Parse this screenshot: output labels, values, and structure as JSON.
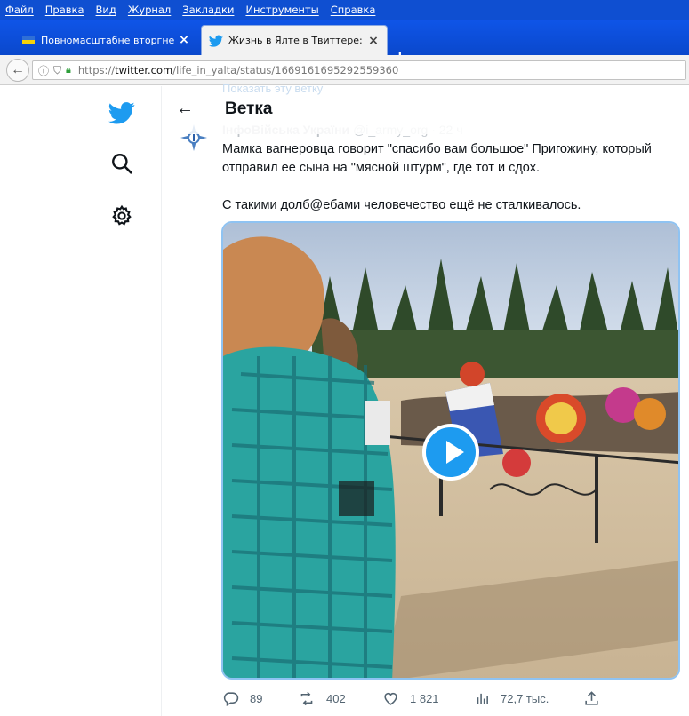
{
  "menu": [
    "Файл",
    "Правка",
    "Вид",
    "Журнал",
    "Закладки",
    "Инструменты",
    "Справка"
  ],
  "tabs": [
    {
      "label": "Повномасштабне вторгненн…"
    },
    {
      "label": "Жизнь в Ялте в Твиттере: «…"
    }
  ],
  "address": {
    "prefix": "https://",
    "domain": "twitter.com",
    "rest": "/life_in_yalta/status/1669161695292559360"
  },
  "header": {
    "ghost_link": "Показать эту ветку",
    "title": "Ветка"
  },
  "tweet": {
    "author_name": "ІнфоВійська України",
    "author_handle": "@i_army_org",
    "time": "· 22 ч",
    "text_p1": "Мамка вагнеровца говорит \"спасибо вам большое\" Пригожину, который отправил ее сына на \"мясной штурм\", где тот и сдох.",
    "text_p2": "С такими долб@ебами человечество ещё не сталкивалось."
  },
  "actions": {
    "replies": "89",
    "retweets": "402",
    "likes": "1 821",
    "views": "72,7 тыс."
  },
  "colors": {
    "twitter_blue": "#1d9bf0",
    "menubar": "#0f4fd1",
    "text_primary": "#0f1419",
    "text_secondary": "#536471"
  }
}
